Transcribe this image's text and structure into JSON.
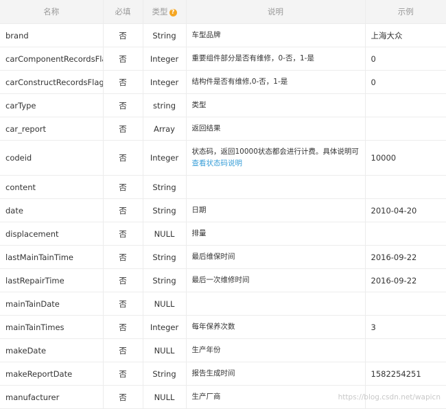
{
  "table": {
    "headers": {
      "name": "名称",
      "required": "必填",
      "type": "类型",
      "type_help_icon": "help-circle-icon",
      "type_help_glyph": "?",
      "description": "说明",
      "example": "示例"
    },
    "rows": [
      {
        "name": "brand",
        "required": "否",
        "type": "String",
        "desc": "车型品牌",
        "example": "上海大众"
      },
      {
        "name": "carComponentRecordsFlag",
        "required": "否",
        "type": "Integer",
        "desc": "重要组件部分是否有维修，0-否，1-是",
        "example": "0"
      },
      {
        "name": "carConstructRecordsFlag",
        "required": "否",
        "type": "Integer",
        "desc": "结构件是否有维修,0-否，1-是",
        "example": "0"
      },
      {
        "name": "carType",
        "required": "否",
        "type": "string",
        "desc": "类型",
        "example": ""
      },
      {
        "name": "car_report",
        "required": "否",
        "type": "Array",
        "desc": "返回结果",
        "example": ""
      },
      {
        "name": "codeid",
        "required": "否",
        "type": "Integer",
        "desc": "状态码，返回10000状态都会进行计费。具体说明可",
        "desc_link": "查看状态码说明",
        "example": "10000"
      },
      {
        "name": "content",
        "required": "否",
        "type": "String",
        "desc": "",
        "example": ""
      },
      {
        "name": "date",
        "required": "否",
        "type": "String",
        "desc": "日期",
        "example": "2010-04-20"
      },
      {
        "name": "displacement",
        "required": "否",
        "type": "NULL",
        "desc": "排量",
        "example": ""
      },
      {
        "name": "lastMainTainTime",
        "required": "否",
        "type": "String",
        "desc": "最后维保时间",
        "example": "2016-09-22"
      },
      {
        "name": "lastRepairTime",
        "required": "否",
        "type": "String",
        "desc": "最后一次维修时间",
        "example": "2016-09-22"
      },
      {
        "name": "mainTainDate",
        "required": "否",
        "type": "NULL",
        "desc": "",
        "example": ""
      },
      {
        "name": "mainTainTimes",
        "required": "否",
        "type": "Integer",
        "desc": "每年保养次数",
        "example": "3"
      },
      {
        "name": "makeDate",
        "required": "否",
        "type": "NULL",
        "desc": "生产年份",
        "example": ""
      },
      {
        "name": "makeReportDate",
        "required": "否",
        "type": "String",
        "desc": "报告生成时间",
        "example": "1582254251"
      },
      {
        "name": "manufacturer",
        "required": "否",
        "type": "NULL",
        "desc": "生产厂商",
        "example": ""
      }
    ]
  },
  "watermark": "https://blog.csdn.net/wapicn"
}
